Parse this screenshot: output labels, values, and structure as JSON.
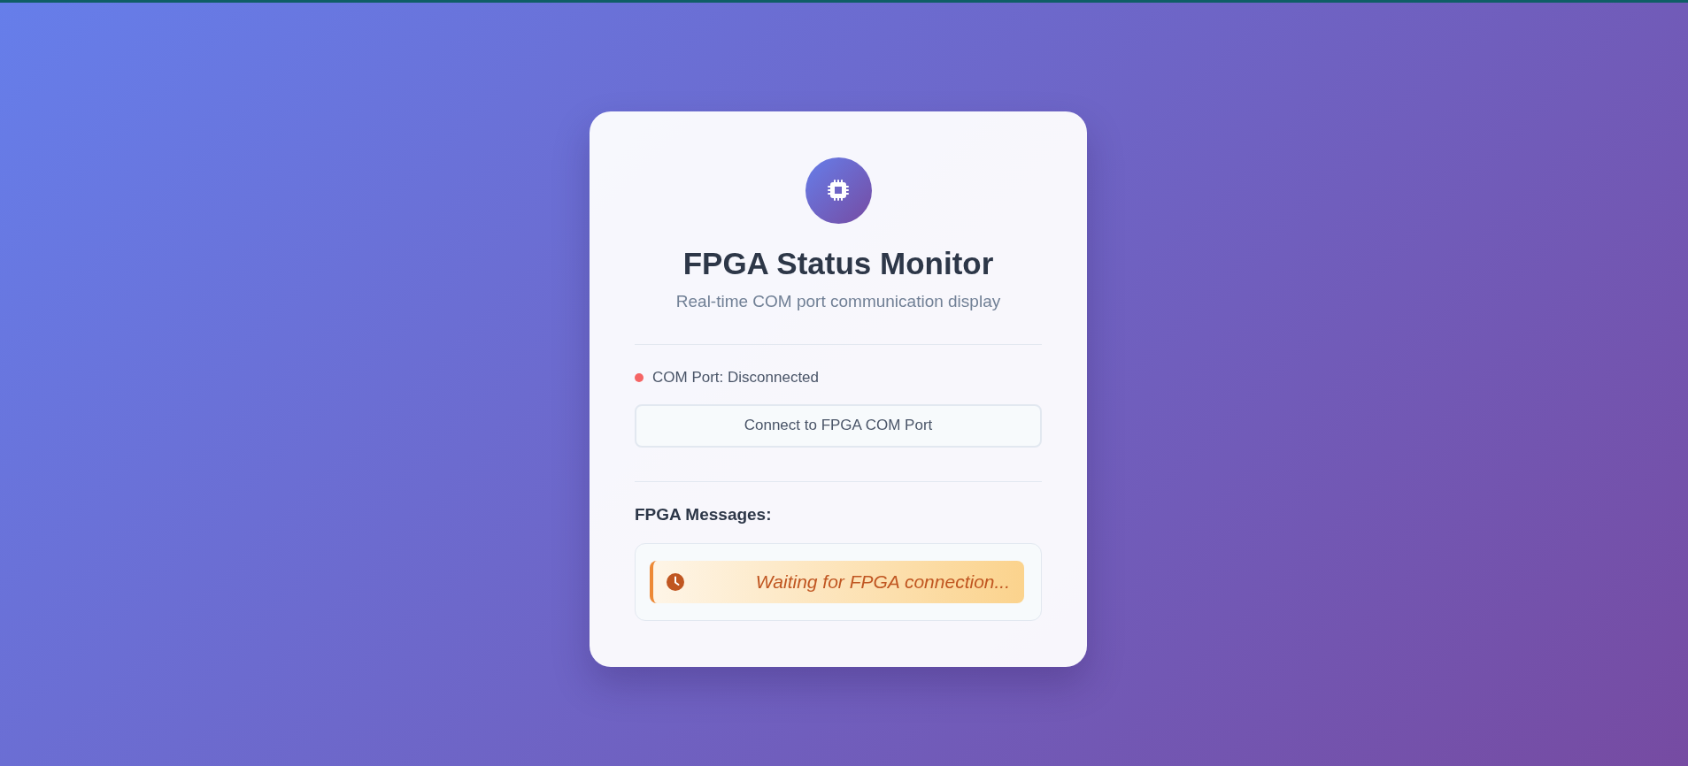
{
  "header": {
    "title": "FPGA Status Monitor",
    "subtitle": "Real-time COM port communication display"
  },
  "status": {
    "label": "COM Port: Disconnected",
    "connected": false
  },
  "connect_button": {
    "label": "Connect to FPGA COM Port"
  },
  "messages": {
    "heading": "FPGA Messages:",
    "items": [
      {
        "kind": "waiting",
        "text": "Waiting for FPGA connection..."
      }
    ]
  }
}
